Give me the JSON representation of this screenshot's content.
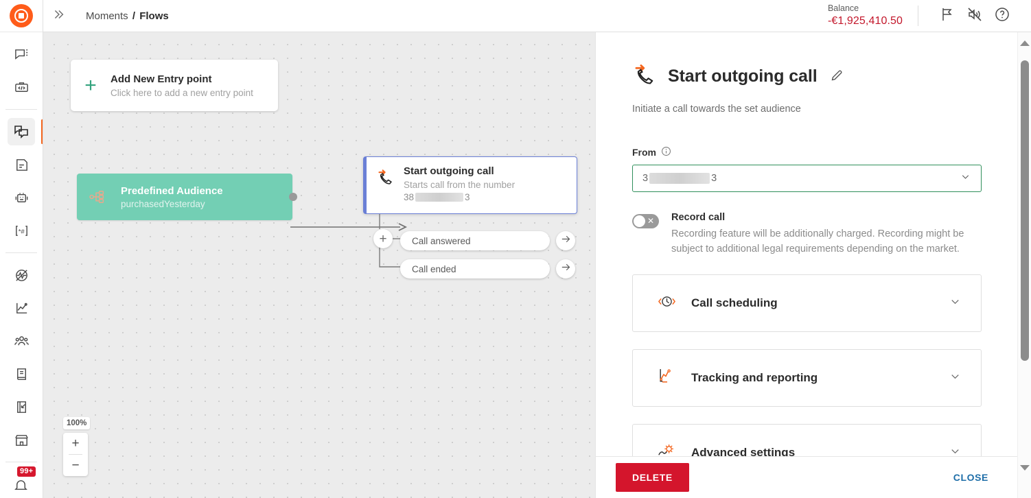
{
  "app": {
    "logo_icon": "infobip-logo-icon"
  },
  "topbar": {
    "collapse_icon": "chevron-double-right-icon",
    "breadcrumb": {
      "root": "Moments",
      "separator": "/",
      "current": "Flows"
    },
    "balance": {
      "label": "Balance",
      "value": "-€1,925,410.50",
      "color": "#c3172b"
    },
    "icons": [
      {
        "name": "announcement-flag-icon"
      },
      {
        "name": "mute-speaker-icon"
      },
      {
        "name": "help-question-icon"
      }
    ]
  },
  "sidebar": {
    "items": [
      {
        "name": "conversations-icon",
        "active": false
      },
      {
        "name": "api-toolbox-icon",
        "active": false
      },
      {
        "name": "moments-flows-icon",
        "active": true
      },
      {
        "name": "templates-icon",
        "active": false
      },
      {
        "name": "chatbot-answers-icon",
        "active": false
      },
      {
        "name": "numbers-icon",
        "active": false
      },
      {
        "name": "analyze-pulse-icon",
        "active": false
      },
      {
        "name": "analytics-chart-icon",
        "active": false
      },
      {
        "name": "people-customers-icon",
        "active": false
      },
      {
        "name": "catalog-book-icon",
        "active": false
      },
      {
        "name": "exit-signout-icon",
        "active": false
      },
      {
        "name": "marketplace-store-icon",
        "active": false
      }
    ],
    "notification_badge": "99+"
  },
  "canvas": {
    "entry_point": {
      "plus_icon": "plus-icon",
      "title": "Add New Entry point",
      "subtitle": "Click here to add a new entry point"
    },
    "audience_node": {
      "icon": "audience-tree-icon",
      "title": "Predefined Audience",
      "subtitle": "purchasedYesterday"
    },
    "call_node": {
      "icon": "outgoing-call-icon",
      "title": "Start outgoing call",
      "subtitle": "Starts call from the number",
      "number_prefix": "38",
      "number_suffix": "3"
    },
    "branch_plus_icon": "plus-icon",
    "branches": [
      {
        "label": "Call answered",
        "arrow_icon": "arrow-right-icon"
      },
      {
        "label": "Call ended",
        "arrow_icon": "arrow-right-icon"
      }
    ],
    "zoom": {
      "level": "100%",
      "zoom_in": "+",
      "zoom_out": "−"
    }
  },
  "panel": {
    "icon": "outgoing-call-icon",
    "title": "Start outgoing call",
    "edit_icon": "pencil-edit-icon",
    "subtitle": "Initiate a call towards the set audience",
    "from": {
      "label": "From",
      "info_icon": "info-circle-icon",
      "value_prefix": "3",
      "value_suffix": "3",
      "caret_icon": "chevron-down-icon",
      "border_color": "#2f8f5b"
    },
    "record_call": {
      "toggle_state": "off",
      "toggle_icon": "toggle-off-icon",
      "title": "Record call",
      "description": "Recording feature will be additionally charged. Recording might be subject to additional legal requirements depending on the market."
    },
    "sections": [
      {
        "icon": "call-scheduling-clock-icon",
        "label": "Call scheduling",
        "caret_icon": "chevron-down-icon"
      },
      {
        "icon": "tracking-chart-icon",
        "label": "Tracking and reporting",
        "caret_icon": "chevron-down-icon"
      },
      {
        "icon": "advanced-settings-gear-icon",
        "label": "Advanced settings",
        "caret_icon": "chevron-down-icon"
      }
    ],
    "footer": {
      "delete_label": "DELETE",
      "delete_color": "#d4152c",
      "close_label": "CLOSE",
      "close_color": "#1e6ea8"
    }
  },
  "scrollbar": {
    "up_icon": "triangle-up-icon",
    "down_icon": "triangle-down-icon"
  }
}
